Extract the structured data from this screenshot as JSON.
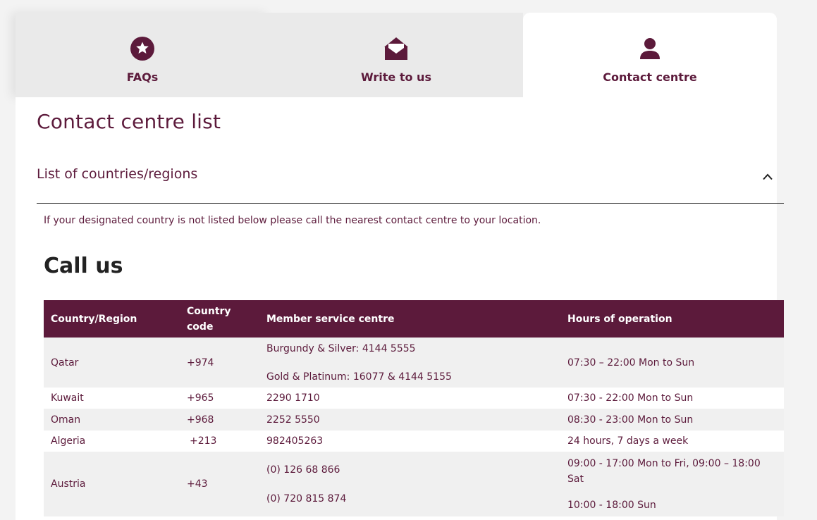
{
  "tabs": [
    {
      "label": "FAQs",
      "icon": "star-icon"
    },
    {
      "label": "Write to us",
      "icon": "envelope-open-icon"
    },
    {
      "label": "Contact centre",
      "icon": "person-icon"
    }
  ],
  "page_title": "Contact centre list",
  "accordion": {
    "label": "List of countries/regions",
    "icon": "chevron-up-icon"
  },
  "note": "If your designated country is not listed below please call the nearest contact centre to your location.",
  "call_title": "Call us",
  "table": {
    "headers": {
      "country": "Country/Region",
      "code_line1": "Country",
      "code_line2": "code",
      "service": "Member service centre",
      "hours": "Hours of operation"
    },
    "rows": [
      {
        "country": "Qatar",
        "code": "+974",
        "service1": "Burgundy & Silver: 4144 5555",
        "service2": "Gold & Platinum: 16077 & 4144 5155",
        "hours1": "07:30 – 22:00 Mon to Sun"
      },
      {
        "country": "Kuwait",
        "code": "+965",
        "service1": "2290 1710",
        "hours1": "07:30 - 22:00 Mon to Sun"
      },
      {
        "country": "Oman",
        "code": "+968",
        "service1": "2252 5550",
        "hours1": "08:30 - 23:00 Mon to Sun"
      },
      {
        "country": "Algeria",
        "code": "+213",
        "service1": "982405263",
        "hours1": "24 hours, 7 days a week"
      },
      {
        "country": "Austria",
        "code": "+43",
        "service1": "(0) 126 68 866",
        "service2": "(0) 720 815 874",
        "hours1": "09:00 - 17:00 Mon to Fri, 09:00 – 18:00 Sat",
        "hours2": "10:00 - 18:00 Sun"
      }
    ]
  },
  "colors": {
    "brand": "#5c1a3b",
    "tab_inactive": "#eaeaea",
    "row_alt": "#f0f0f0"
  }
}
